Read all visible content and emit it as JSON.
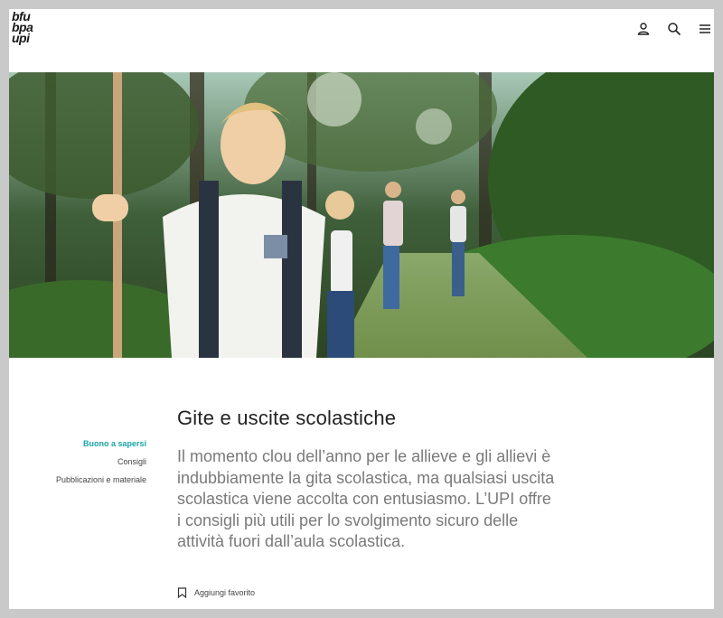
{
  "header": {
    "logo_lines": [
      "bfu",
      "bpa",
      "upi"
    ],
    "icons": [
      "user-icon",
      "search-icon",
      "menu-icon"
    ]
  },
  "hero": {
    "icons": [
      "walking-stick"
    ]
  },
  "sidebar": {
    "items": [
      {
        "label": "Buono a sapersi",
        "active": true
      },
      {
        "label": "Consigli",
        "active": false
      },
      {
        "label": "Pubblicazioni e materiale",
        "active": false
      }
    ]
  },
  "main": {
    "title": "Gite e uscite scolastiche",
    "lead": "Il momento clou dell’anno per le allieve e gli allievi è indubbiamente la gita scolastica, ma qualsiasi uscita scolastica viene accolta con entusiasmo. L’UPI offre i consigli più utili per lo svolgimento sicuro delle attività fuori dall’aula scolastica.",
    "favorite_label": "Aggiungi favorito"
  },
  "colors": {
    "accent": "#1aa5a5",
    "title": "#222222",
    "lead": "#7a7a7a",
    "frame_bg": "#c9c9c9"
  }
}
